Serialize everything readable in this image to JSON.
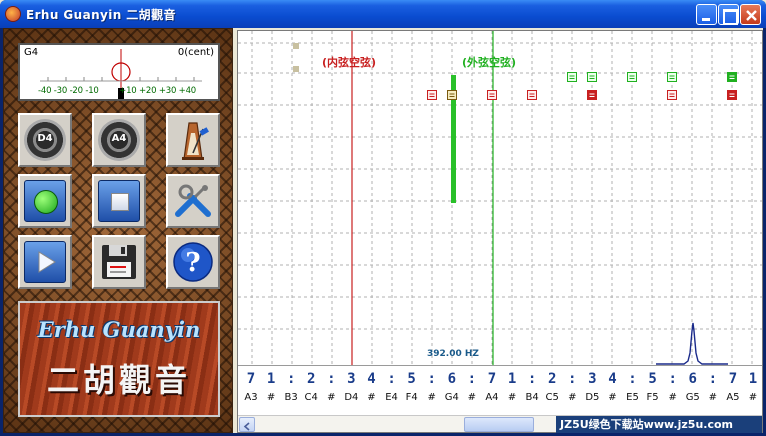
{
  "window": {
    "title": "Erhu Guanyin 二胡觀音",
    "controls": {
      "minimize": "minimize",
      "maximize": "maximize",
      "close": "close"
    }
  },
  "tuner": {
    "note": "G4",
    "cent_label": "0(cent)",
    "scale_left": "-40 -30 -20 -10",
    "scale_right": "+10 +20 +30 +40"
  },
  "toolbar": {
    "d4_label": "D4",
    "a4_label": "A4"
  },
  "logo": {
    "english": "Erhu Guanyin",
    "chinese": "二胡觀音"
  },
  "plot": {
    "inner_string_label": "(内弦空弦)",
    "outer_string_label": "(外弦空弦)",
    "frequency_label": "392.00 HZ"
  },
  "scale_numbers": [
    "7",
    "1",
    ":",
    "2",
    ":",
    "3",
    "4",
    ":",
    "5",
    ":",
    "6",
    ":",
    "7",
    "1",
    ":",
    "2",
    ":",
    "3",
    "4",
    ":",
    "5",
    ":",
    "6",
    ":",
    "7",
    "1"
  ],
  "scale_notes": [
    "A3",
    "#",
    "B3",
    "C4",
    "#",
    "D4",
    "#",
    "E4",
    "F4",
    "#",
    "G4",
    "#",
    "A4",
    "#",
    "B4",
    "C5",
    "#",
    "D5",
    "#",
    "E5",
    "F5",
    "#",
    "G5",
    "#",
    "A5",
    "#"
  ],
  "watermark": "JZ5U绿色下载站www.jz5u.com"
}
